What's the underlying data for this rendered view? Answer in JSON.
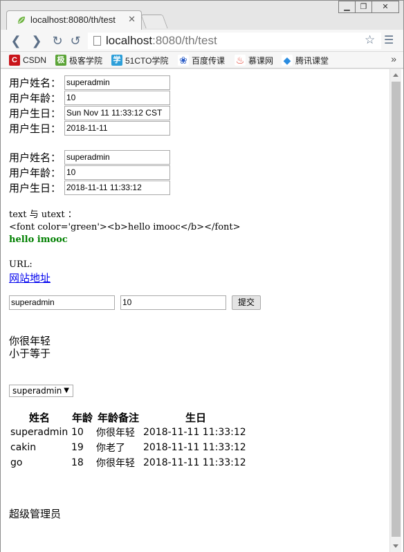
{
  "browser": {
    "tab_title": "localhost:8080/th/test",
    "url_host": "localhost",
    "url_rest": ":8080/th/test",
    "bookmarks": [
      "CSDN",
      "极客学院",
      "51CTO学院",
      "百度传课",
      "慕课网",
      "腾讯课堂"
    ],
    "more": "»"
  },
  "form1": {
    "rows": [
      {
        "label": "用户姓名：",
        "value": "superadmin"
      },
      {
        "label": "用户年龄：",
        "value": "10"
      },
      {
        "label": "用户生日：",
        "value": "Sun Nov 11 11:33:12 CST"
      },
      {
        "label": "用户生日：",
        "value": "2018-11-11"
      }
    ]
  },
  "form2": {
    "rows": [
      {
        "label": "用户姓名：",
        "value": "superadmin"
      },
      {
        "label": "用户年龄：",
        "value": "10"
      },
      {
        "label": "用户生日：",
        "value": "2018-11-11 11:33:12"
      }
    ]
  },
  "text_utext": {
    "heading": "text 与 utext ：",
    "raw": "<font color='green'><b>hello imooc</b></font>",
    "rendered": "hello imooc"
  },
  "url_section": {
    "label": "URL:",
    "link": "网站地址"
  },
  "inline_form": {
    "name_value": "superadmin",
    "age_value": "10",
    "submit": "提交"
  },
  "conditions": {
    "line1": "你很年轻",
    "line2": "小于等于"
  },
  "select": {
    "selected": "superadmin"
  },
  "users_table": {
    "headers": [
      "姓名",
      "年龄",
      "年龄备注",
      "生日"
    ],
    "rows": [
      [
        "superadmin",
        "10",
        "你很年轻",
        "2018-11-11 11:33:12"
      ],
      [
        "cakin",
        "19",
        "你老了",
        "2018-11-11 11:33:12"
      ],
      [
        "go",
        "18",
        "你很年轻",
        "2018-11-11 11:33:12"
      ]
    ]
  },
  "role": "超级管理员"
}
